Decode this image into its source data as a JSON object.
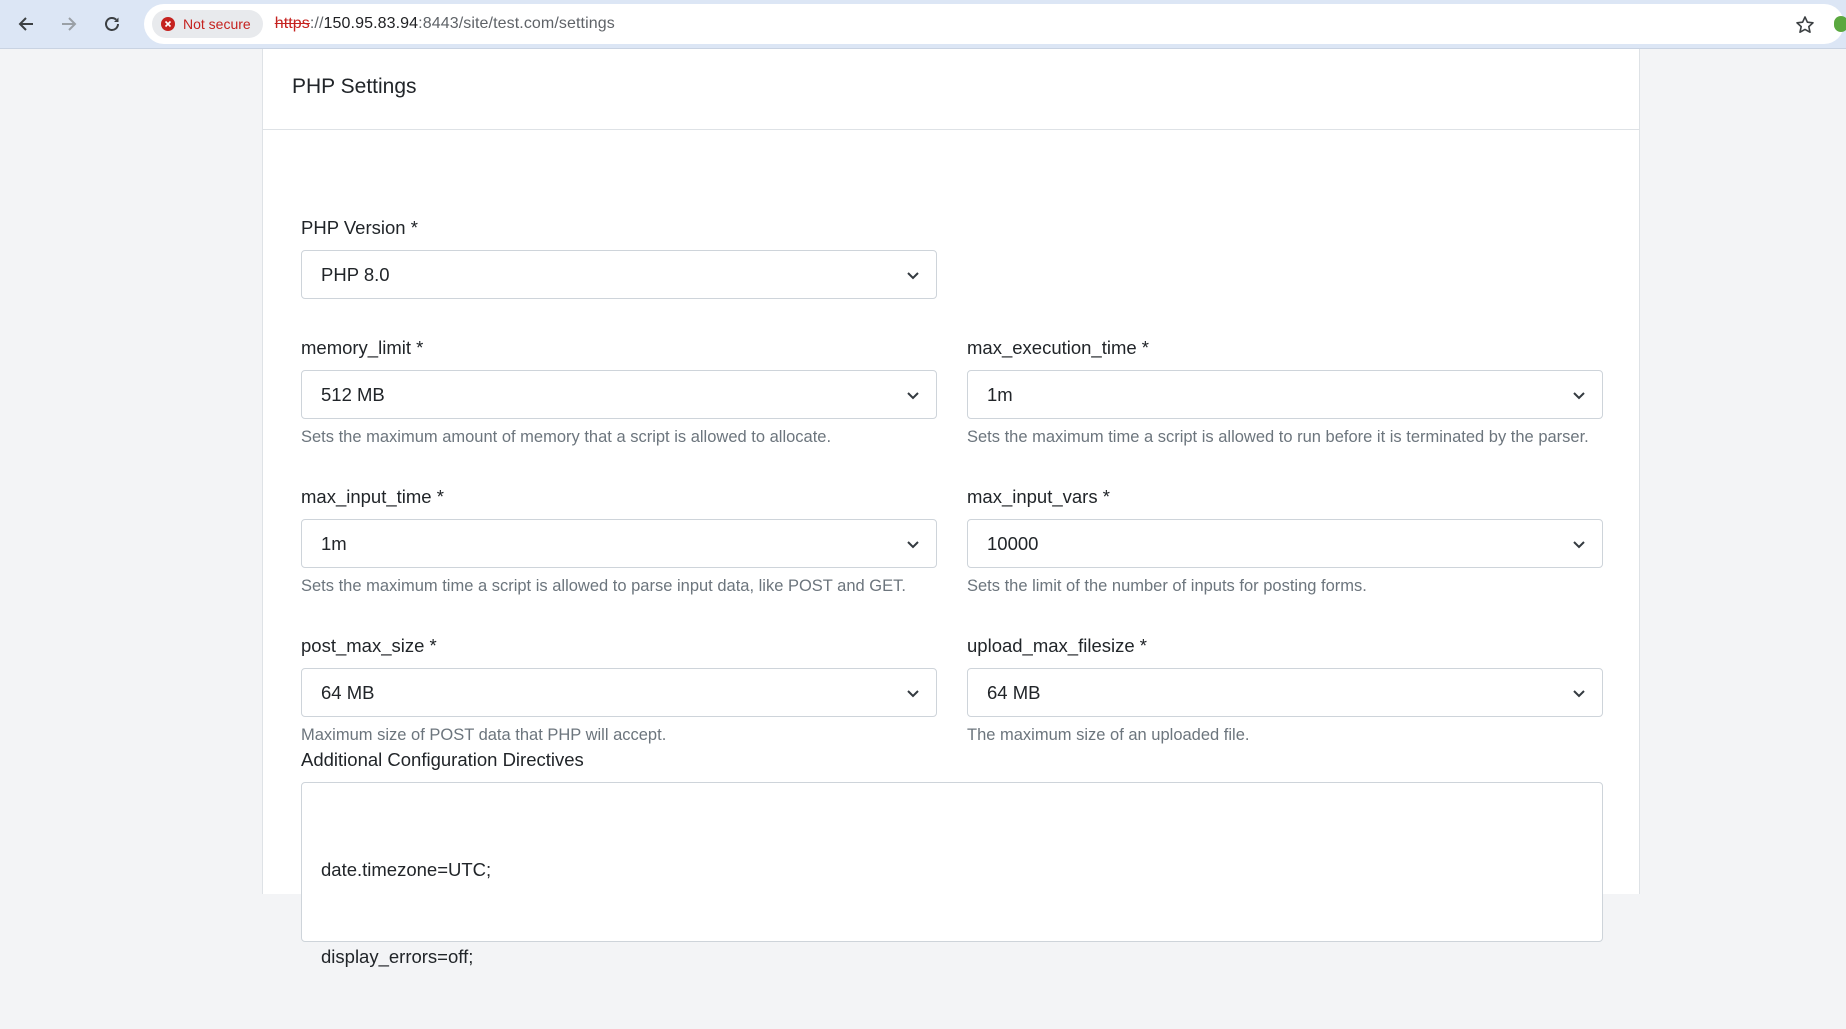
{
  "browser": {
    "security_label": "Not secure",
    "url_protocol": "https",
    "url_host": "150.95.83.94",
    "url_rest": ":8443/site/test.com/settings"
  },
  "card": {
    "title": "PHP Settings"
  },
  "fields": {
    "php_version": {
      "label": "PHP Version *",
      "value": "PHP 8.0"
    },
    "memory_limit": {
      "label": "memory_limit *",
      "value": "512 MB",
      "help": "Sets the maximum amount of memory that a script is allowed to allocate."
    },
    "max_execution_time": {
      "label": "max_execution_time *",
      "value": "1m",
      "help": "Sets the maximum time a script is allowed to run before it is terminated by the parser."
    },
    "max_input_time": {
      "label": "max_input_time *",
      "value": "1m",
      "help": "Sets the maximum time a script is allowed to parse input data, like POST and GET."
    },
    "max_input_vars": {
      "label": "max_input_vars *",
      "value": "10000",
      "help": "Sets the limit of the number of inputs for posting forms."
    },
    "post_max_size": {
      "label": "post_max_size *",
      "value": "64 MB",
      "help": "Maximum size of POST data that PHP will accept."
    },
    "upload_max_filesize": {
      "label": "upload_max_filesize *",
      "value": "64 MB",
      "help": "The maximum size of an uploaded file."
    }
  },
  "directives": {
    "label": "Additional Configuration Directives",
    "lines": [
      "date.timezone=UTC;",
      "display_errors=off;"
    ]
  }
}
